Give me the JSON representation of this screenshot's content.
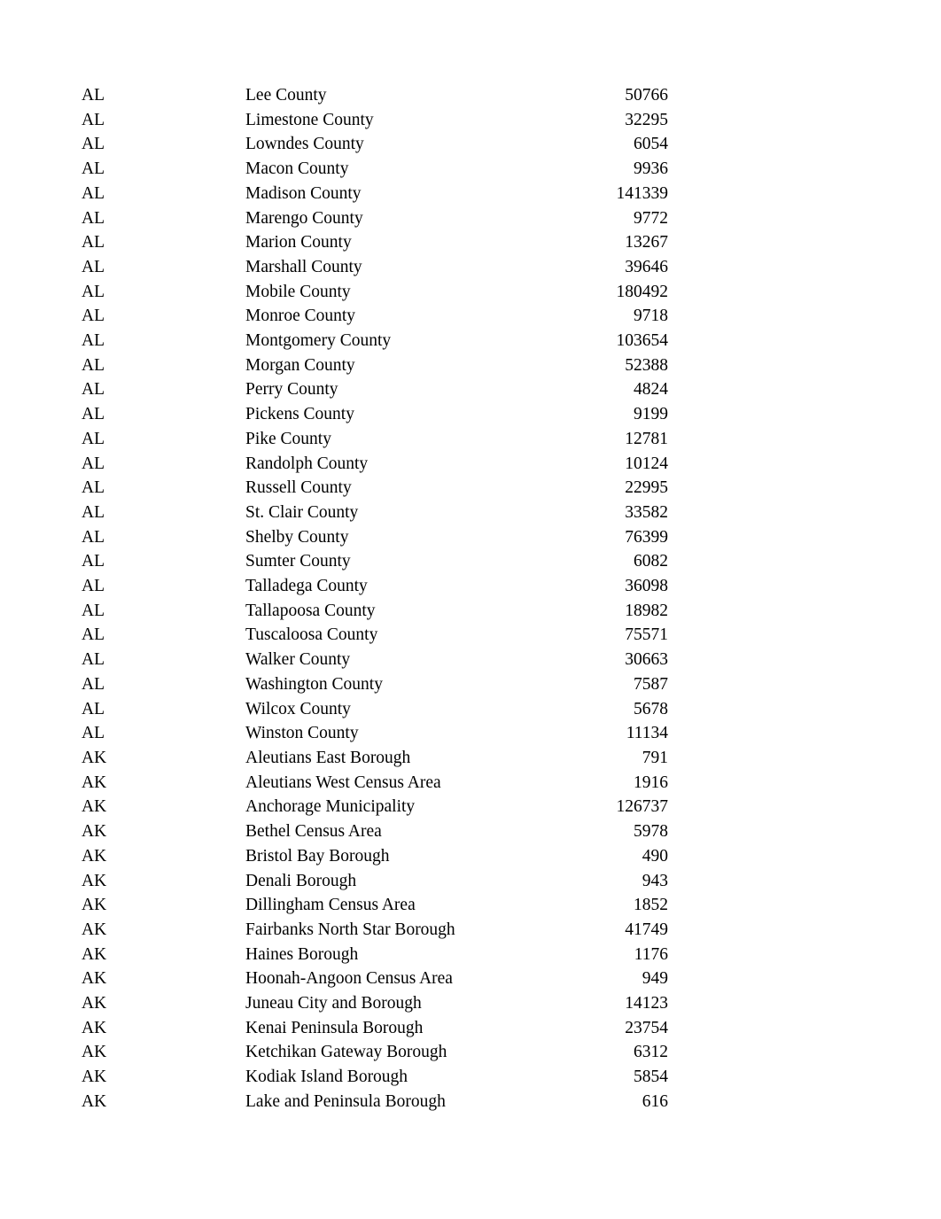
{
  "document": {
    "background_color": "#ffffff",
    "text_color": "#000000"
  },
  "table": {
    "columns": [
      {
        "key": "state",
        "align": "left"
      },
      {
        "key": "county",
        "align": "left"
      },
      {
        "key": "value",
        "align": "right"
      }
    ],
    "rows": [
      {
        "state": "AL",
        "county": "Lee County",
        "value": "50766"
      },
      {
        "state": "AL",
        "county": "Limestone County",
        "value": "32295"
      },
      {
        "state": "AL",
        "county": "Lowndes County",
        "value": "6054"
      },
      {
        "state": "AL",
        "county": "Macon County",
        "value": "9936"
      },
      {
        "state": "AL",
        "county": "Madison County",
        "value": "141339"
      },
      {
        "state": "AL",
        "county": "Marengo County",
        "value": "9772"
      },
      {
        "state": "AL",
        "county": "Marion County",
        "value": "13267"
      },
      {
        "state": "AL",
        "county": "Marshall County",
        "value": "39646"
      },
      {
        "state": "AL",
        "county": "Mobile County",
        "value": "180492"
      },
      {
        "state": "AL",
        "county": "Monroe County",
        "value": "9718"
      },
      {
        "state": "AL",
        "county": "Montgomery County",
        "value": "103654"
      },
      {
        "state": "AL",
        "county": "Morgan County",
        "value": "52388"
      },
      {
        "state": "AL",
        "county": "Perry County",
        "value": "4824"
      },
      {
        "state": "AL",
        "county": "Pickens County",
        "value": "9199"
      },
      {
        "state": "AL",
        "county": "Pike County",
        "value": "12781"
      },
      {
        "state": "AL",
        "county": "Randolph County",
        "value": "10124"
      },
      {
        "state": "AL",
        "county": "Russell County",
        "value": "22995"
      },
      {
        "state": "AL",
        "county": "St. Clair County",
        "value": "33582"
      },
      {
        "state": "AL",
        "county": "Shelby County",
        "value": "76399"
      },
      {
        "state": "AL",
        "county": "Sumter County",
        "value": "6082"
      },
      {
        "state": "AL",
        "county": "Talladega County",
        "value": "36098"
      },
      {
        "state": "AL",
        "county": "Tallapoosa County",
        "value": "18982"
      },
      {
        "state": "AL",
        "county": "Tuscaloosa County",
        "value": "75571"
      },
      {
        "state": "AL",
        "county": "Walker County",
        "value": "30663"
      },
      {
        "state": "AL",
        "county": "Washington County",
        "value": "7587"
      },
      {
        "state": "AL",
        "county": "Wilcox County",
        "value": "5678"
      },
      {
        "state": "AL",
        "county": "Winston County",
        "value": "11134"
      },
      {
        "state": "AK",
        "county": "Aleutians East Borough",
        "value": "791"
      },
      {
        "state": "AK",
        "county": "Aleutians West Census Area",
        "value": "1916"
      },
      {
        "state": "AK",
        "county": "Anchorage Municipality",
        "value": "126737"
      },
      {
        "state": "AK",
        "county": "Bethel Census Area",
        "value": "5978"
      },
      {
        "state": "AK",
        "county": "Bristol Bay Borough",
        "value": "490"
      },
      {
        "state": "AK",
        "county": "Denali Borough",
        "value": "943"
      },
      {
        "state": "AK",
        "county": "Dillingham Census Area",
        "value": "1852"
      },
      {
        "state": "AK",
        "county": "Fairbanks North Star Borough",
        "value": "41749"
      },
      {
        "state": "AK",
        "county": "Haines Borough",
        "value": "1176"
      },
      {
        "state": "AK",
        "county": "Hoonah-Angoon Census Area",
        "value": "949"
      },
      {
        "state": "AK",
        "county": "Juneau City and Borough",
        "value": "14123"
      },
      {
        "state": "AK",
        "county": "Kenai Peninsula Borough",
        "value": "23754"
      },
      {
        "state": "AK",
        "county": "Ketchikan Gateway Borough",
        "value": "6312"
      },
      {
        "state": "AK",
        "county": "Kodiak Island Borough",
        "value": "5854"
      },
      {
        "state": "AK",
        "county": "Lake and Peninsula Borough",
        "value": "616"
      }
    ]
  }
}
